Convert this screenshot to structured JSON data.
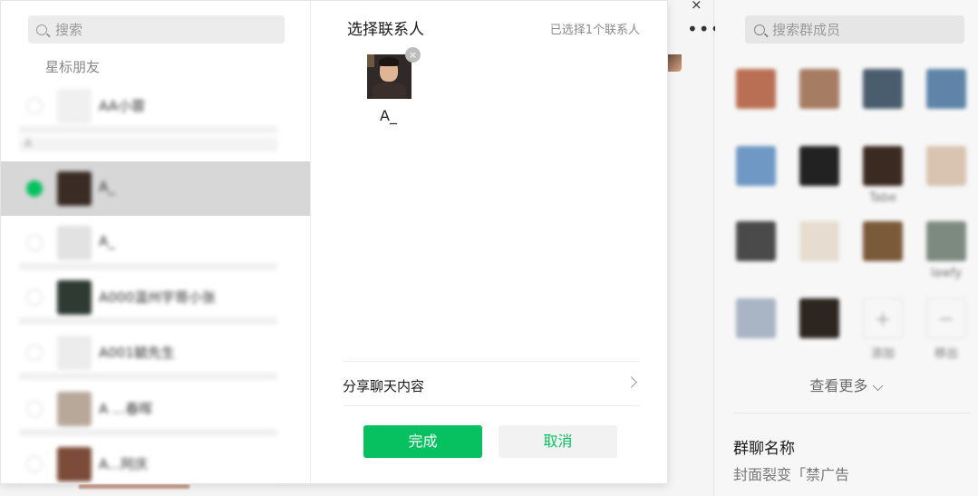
{
  "background_chat": {
    "close_icon": "×",
    "more_icon": "•••"
  },
  "side_panel": {
    "search_placeholder": "搜索群成员",
    "members": [
      {
        "name": "",
        "color": "#b86f54"
      },
      {
        "name": "",
        "color": "#a67c62"
      },
      {
        "name": "",
        "color": "#4a5d6e"
      },
      {
        "name": "",
        "color": "#5f84a8"
      },
      {
        "name": "",
        "color": "#6f98c4"
      },
      {
        "name": "",
        "color": "#222222"
      },
      {
        "name": "Tabe",
        "color": "#3b2a22"
      },
      {
        "name": "",
        "color": "#d8c4b0"
      },
      {
        "name": "",
        "color": "#4a4a4a"
      },
      {
        "name": "",
        "color": "#e6ddd0"
      },
      {
        "name": "",
        "color": "#7b5a3a"
      },
      {
        "name": "lawfy",
        "color": "#7d8a80"
      },
      {
        "name": "",
        "color": "#a9b4c4"
      },
      {
        "name": "",
        "color": "#2d2520"
      }
    ],
    "add_label": "添加",
    "remove_label": "移出",
    "more_members": "查看更多",
    "group_name_label": "群聊名称",
    "group_name_value": "封面裂变「禁广告"
  },
  "dialog": {
    "search_placeholder": "搜索",
    "starred_label": "星标朋友",
    "contacts": [
      {
        "name": "AA小蓉",
        "color": "#f0f0f0",
        "selected": false
      },
      {
        "name": "A_",
        "color": "#3a2c25",
        "selected": true
      },
      {
        "name": "A_",
        "color": "#e2e2e2",
        "selected": false
      },
      {
        "name": "A000温州宇哥小张",
        "color": "#2f3a33",
        "selected": false
      },
      {
        "name": "A001毓先生",
        "color": "#ececec",
        "selected": false
      },
      {
        "name": "A ...春晖",
        "color": "#b8a89a",
        "selected": false
      },
      {
        "name": "A...阿庆",
        "color": "#7c4b3a",
        "selected": false
      }
    ],
    "section_letter": "A",
    "title": "选择联系人",
    "selected_count": "已选择1个联系人",
    "selected_contact_name": "A_",
    "remove_icon": "×",
    "share_chat_label": "分享聊天内容",
    "done_button": "完成",
    "cancel_button": "取消"
  },
  "colors": {
    "accent": "#07c160",
    "selected_row": "#d7d7d7"
  }
}
